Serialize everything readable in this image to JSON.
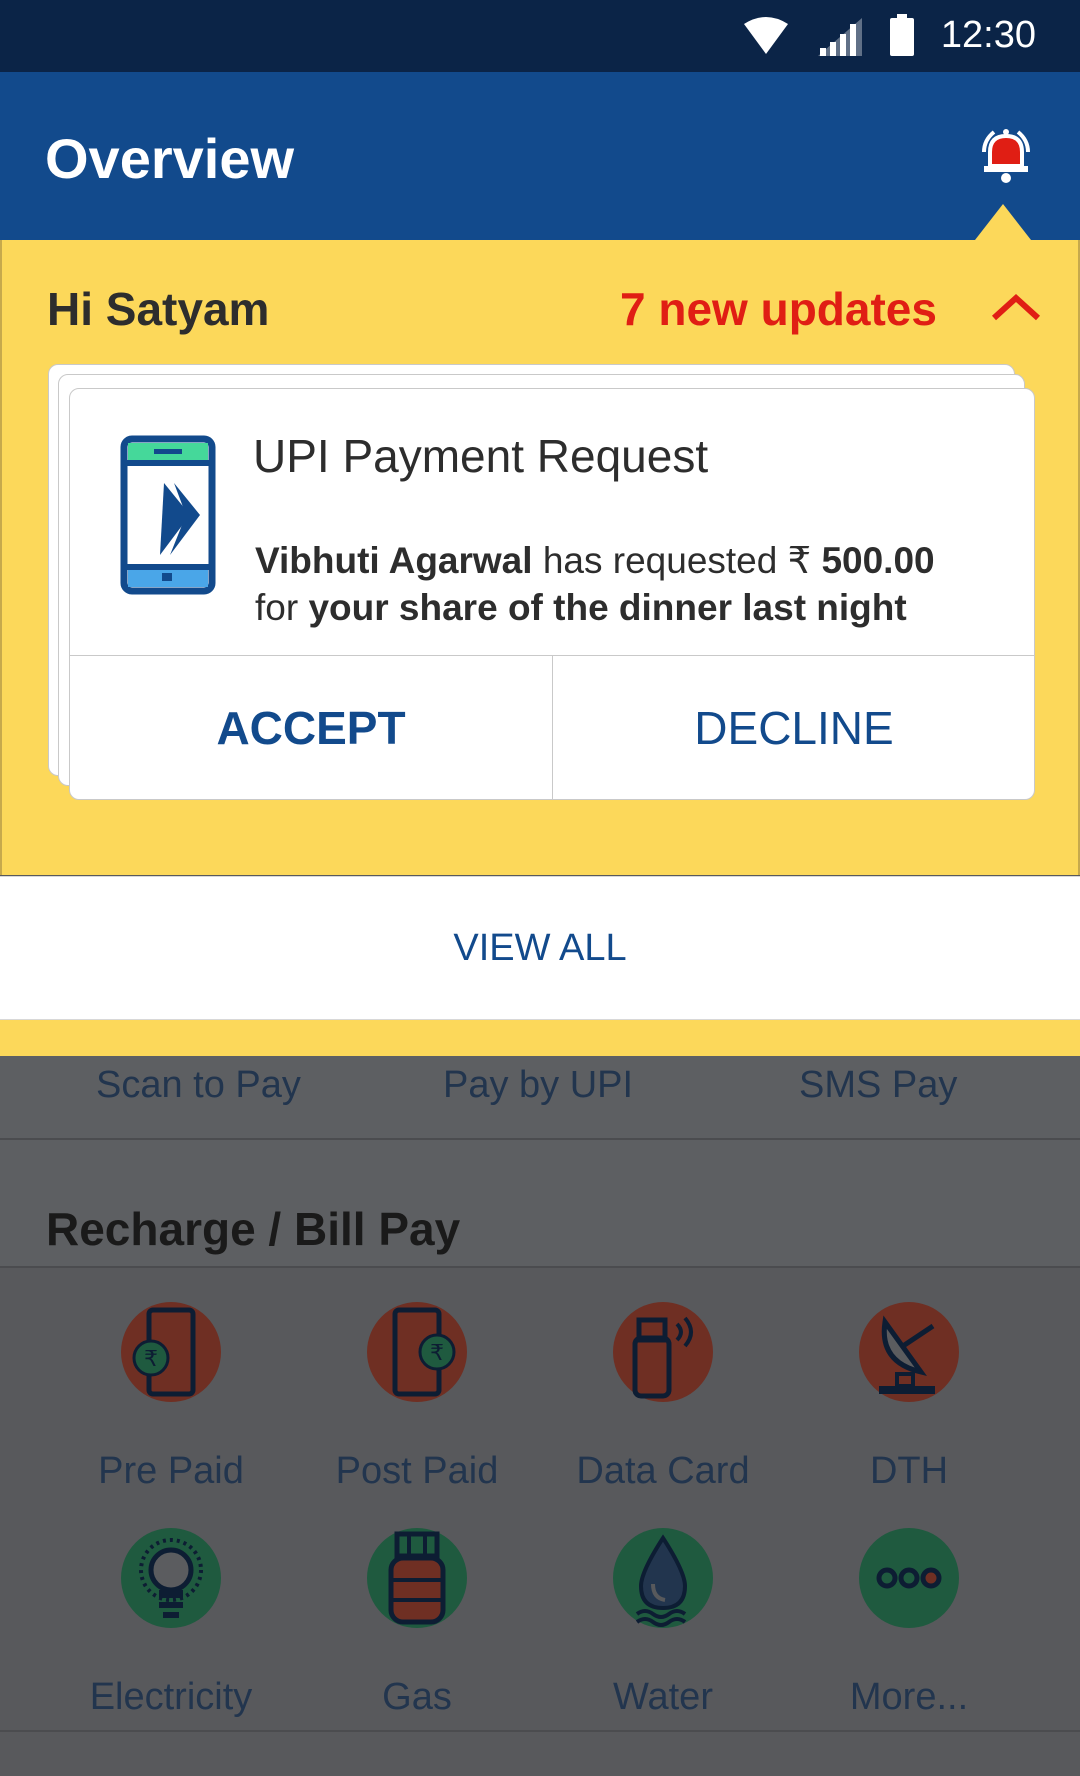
{
  "status": {
    "time": "12:30"
  },
  "appbar": {
    "title": "Overview"
  },
  "banner": {
    "greeting": "Hi Satyam",
    "updates": "7 new updates"
  },
  "card": {
    "title": "UPI Payment Request",
    "requester": "Vibhuti Agarwal",
    "requested_text": " has requested ₹ ",
    "amount": "500.00",
    "for_text": "for ",
    "reason": "your share of the dinner last night",
    "accept": "ACCEPT",
    "decline": "DECLINE"
  },
  "view_all": "VIEW ALL",
  "pay_options": [
    "Scan to Pay",
    "Pay by UPI",
    "SMS Pay"
  ],
  "section_title": "Recharge / Bill Pay",
  "services": [
    {
      "label": "Pre Paid",
      "icon": "prepaid-icon"
    },
    {
      "label": "Post Paid",
      "icon": "postpaid-icon"
    },
    {
      "label": "Data Card",
      "icon": "datacard-icon"
    },
    {
      "label": "DTH",
      "icon": "dth-icon"
    },
    {
      "label": "Electricity",
      "icon": "electricity-icon"
    },
    {
      "label": "Gas",
      "icon": "gas-icon"
    },
    {
      "label": "Water",
      "icon": "water-icon"
    },
    {
      "label": "More...",
      "icon": "more-icon"
    }
  ],
  "colors": {
    "primary": "#124a8c",
    "accent_yellow": "#fcd85a",
    "alert_red": "#e01e14",
    "statusbar": "#0b2447"
  }
}
